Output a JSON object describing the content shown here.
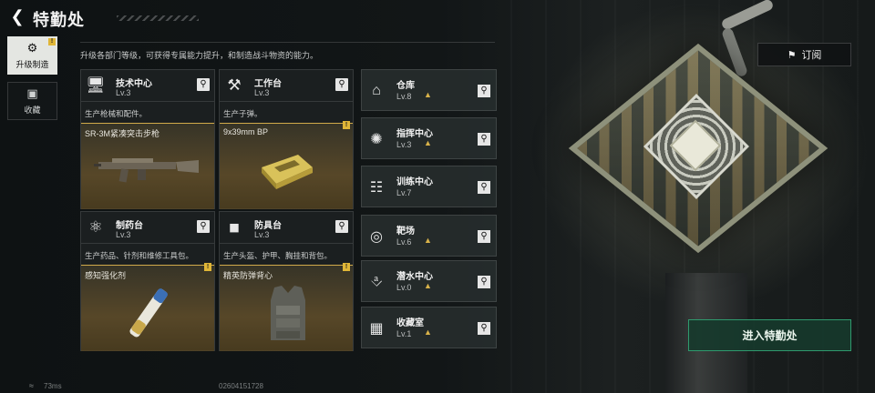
{
  "header": {
    "title": "特勤处",
    "description": "升级各部门等级，可获得专属能力提升，和制造战斗物资的能力。"
  },
  "sidebar": {
    "tabs": [
      {
        "label": "升级制造",
        "icon": "upgrade-icon",
        "active": true,
        "badge": "!"
      },
      {
        "label": "收藏",
        "icon": "collection-icon",
        "active": false
      }
    ]
  },
  "cards": [
    {
      "name": "技术中心",
      "level": "Lv.3",
      "desc": "生产枪械和配件。",
      "item": "SR-3M紧凑突击步枪",
      "icon": "monitor-icon",
      "badge": ""
    },
    {
      "name": "工作台",
      "level": "Lv.3",
      "desc": "生产子弹。",
      "item": "9x39mm BP",
      "icon": "tools-icon",
      "badge": "!"
    },
    {
      "name": "制药台",
      "level": "Lv.3",
      "desc": "生产药品、针剂和维修工具包。",
      "item": "感知强化剂",
      "icon": "microscope-icon",
      "badge": "!"
    },
    {
      "name": "防具台",
      "level": "Lv.3",
      "desc": "生产头盔、护甲、胸挂和背包。",
      "item": "精英防弹背心",
      "icon": "armor-icon",
      "badge": "!"
    }
  ],
  "facilities": [
    {
      "name": "仓库",
      "level": "Lv.8",
      "icon": "warehouse-icon"
    },
    {
      "name": "指挥中心",
      "level": "Lv.3",
      "icon": "chip-icon"
    },
    {
      "name": "训练中心",
      "level": "Lv.7",
      "icon": "dumbbell-icon"
    },
    {
      "name": "靶场",
      "level": "Lv.6",
      "icon": "target-icon"
    },
    {
      "name": "潜水中心",
      "level": "Lv.0",
      "icon": "diving-icon"
    },
    {
      "name": "收藏室",
      "level": "Lv.1",
      "icon": "vault-icon"
    }
  ],
  "buttons": {
    "subscribe": "订阅",
    "enter": "进入特勤处"
  },
  "footer": {
    "ping": "73ms",
    "uid": "02604151728"
  },
  "colors": {
    "accent_gold": "#e0b637",
    "enter_green": "#2f9a6e"
  }
}
